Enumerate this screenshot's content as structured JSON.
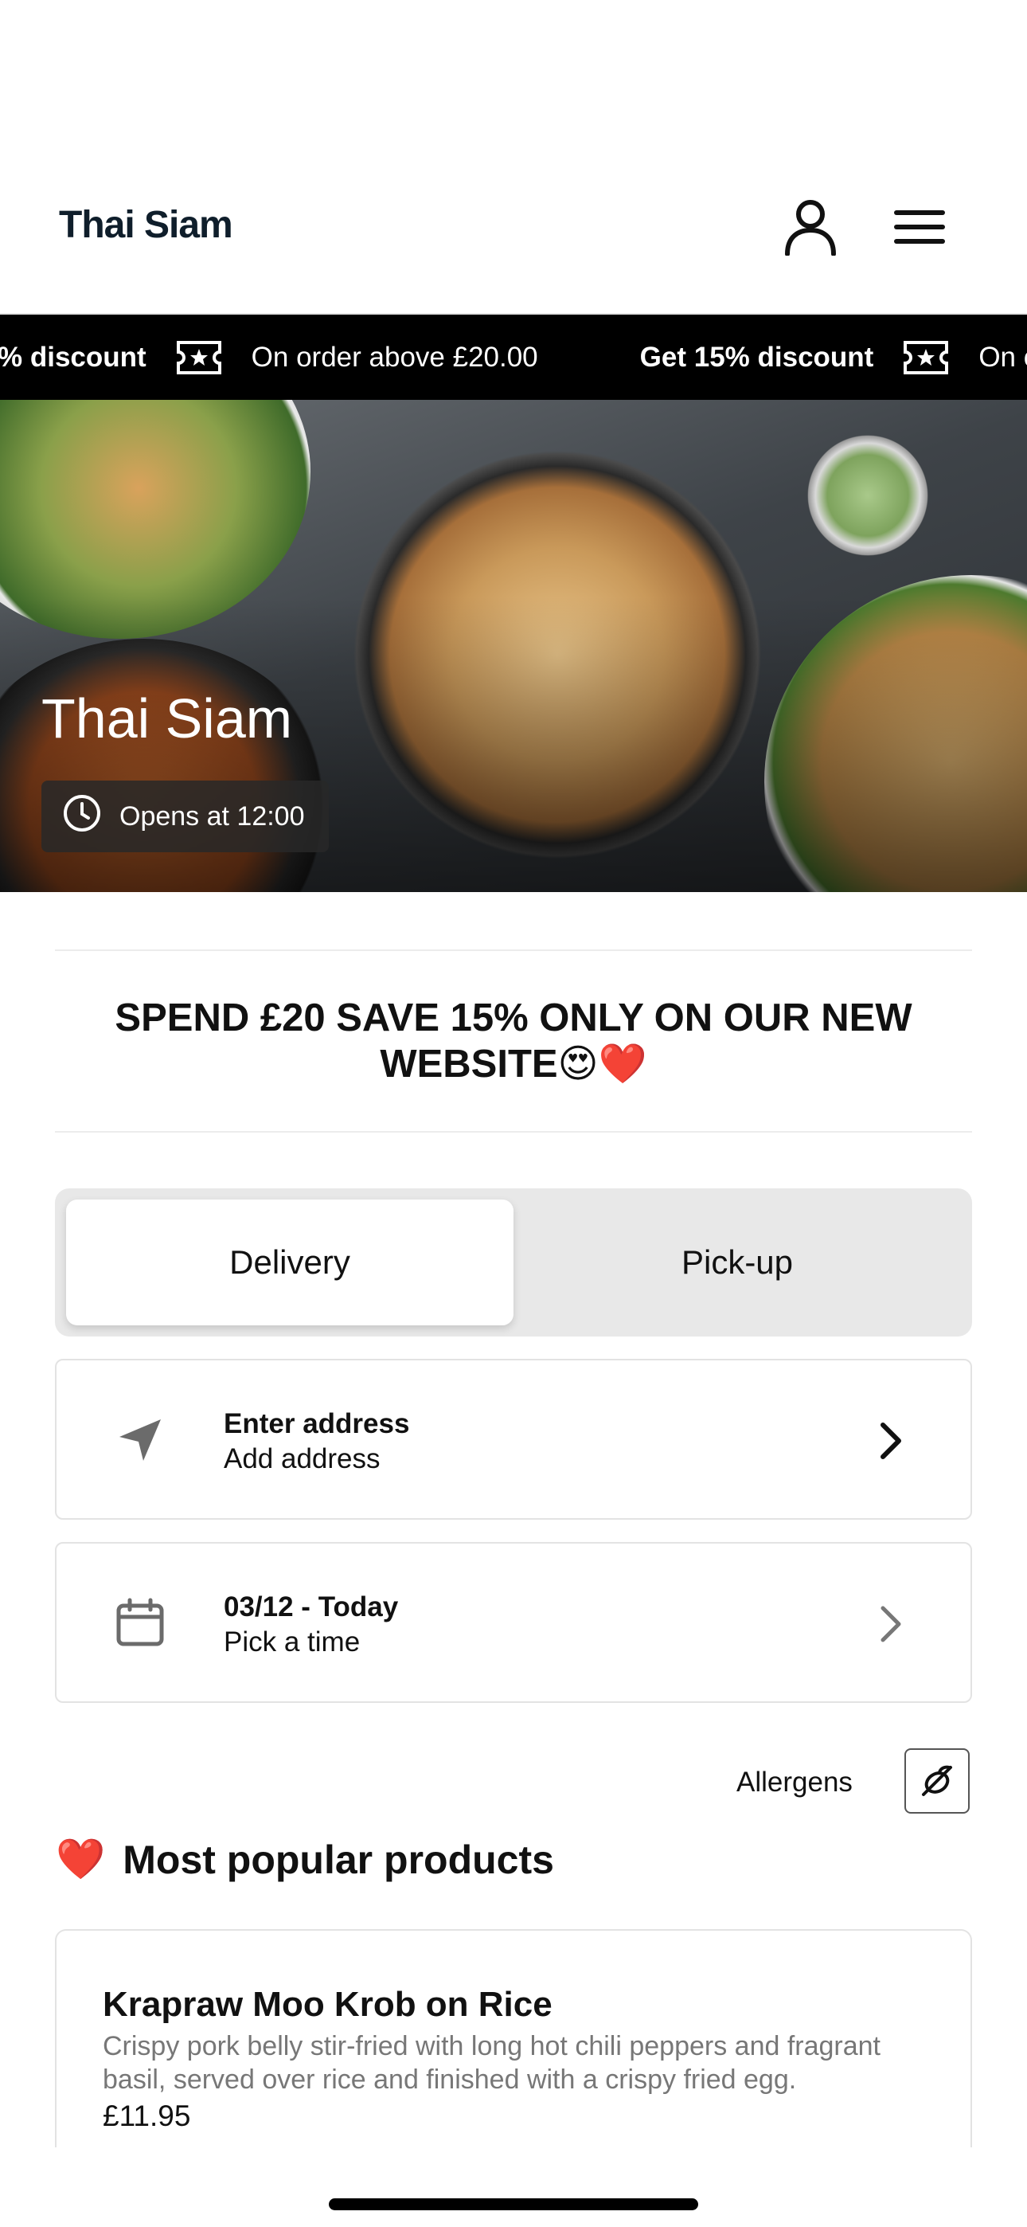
{
  "header": {
    "brand": "Thai Siam",
    "account_icon": "user-icon",
    "menu_icon": "hamburger-menu-icon"
  },
  "ticker": {
    "items": [
      {
        "bold": "Get 15% discount",
        "text": "On order above £20.00"
      },
      {
        "bold": "Get 15% discount",
        "text": "On order above £20.00"
      }
    ]
  },
  "hero": {
    "title": "Thai Siam",
    "opening": "Opens at 12:00"
  },
  "promo": {
    "text": "SPEND £20 SAVE 15% ONLY ON OUR NEW WEBSITE😍❤️"
  },
  "order_mode": {
    "delivery": "Delivery",
    "pickup": "Pick-up",
    "selected": "Delivery"
  },
  "address": {
    "title": "Enter address",
    "subtitle": "Add address",
    "icon": "location-arrow-icon"
  },
  "time": {
    "title": "03/12 - Today",
    "subtitle": "Pick a time",
    "icon": "calendar-icon"
  },
  "allergens": {
    "label": "Allergens",
    "icon": "allergen-filter-icon"
  },
  "popular": {
    "emoji": "❤️",
    "title": "Most popular products",
    "products": [
      {
        "name": "Krapraw Moo Krob on Rice",
        "description": "Crispy pork belly stir-fried with long hot chili peppers and fragrant basil, served over rice and finished with a crispy fried egg.",
        "price": "£11.95"
      }
    ]
  },
  "colors": {
    "brand_text": "#0f1e2b",
    "ticker_bg": "#000000",
    "toggle_bg": "#e8e8e8"
  }
}
